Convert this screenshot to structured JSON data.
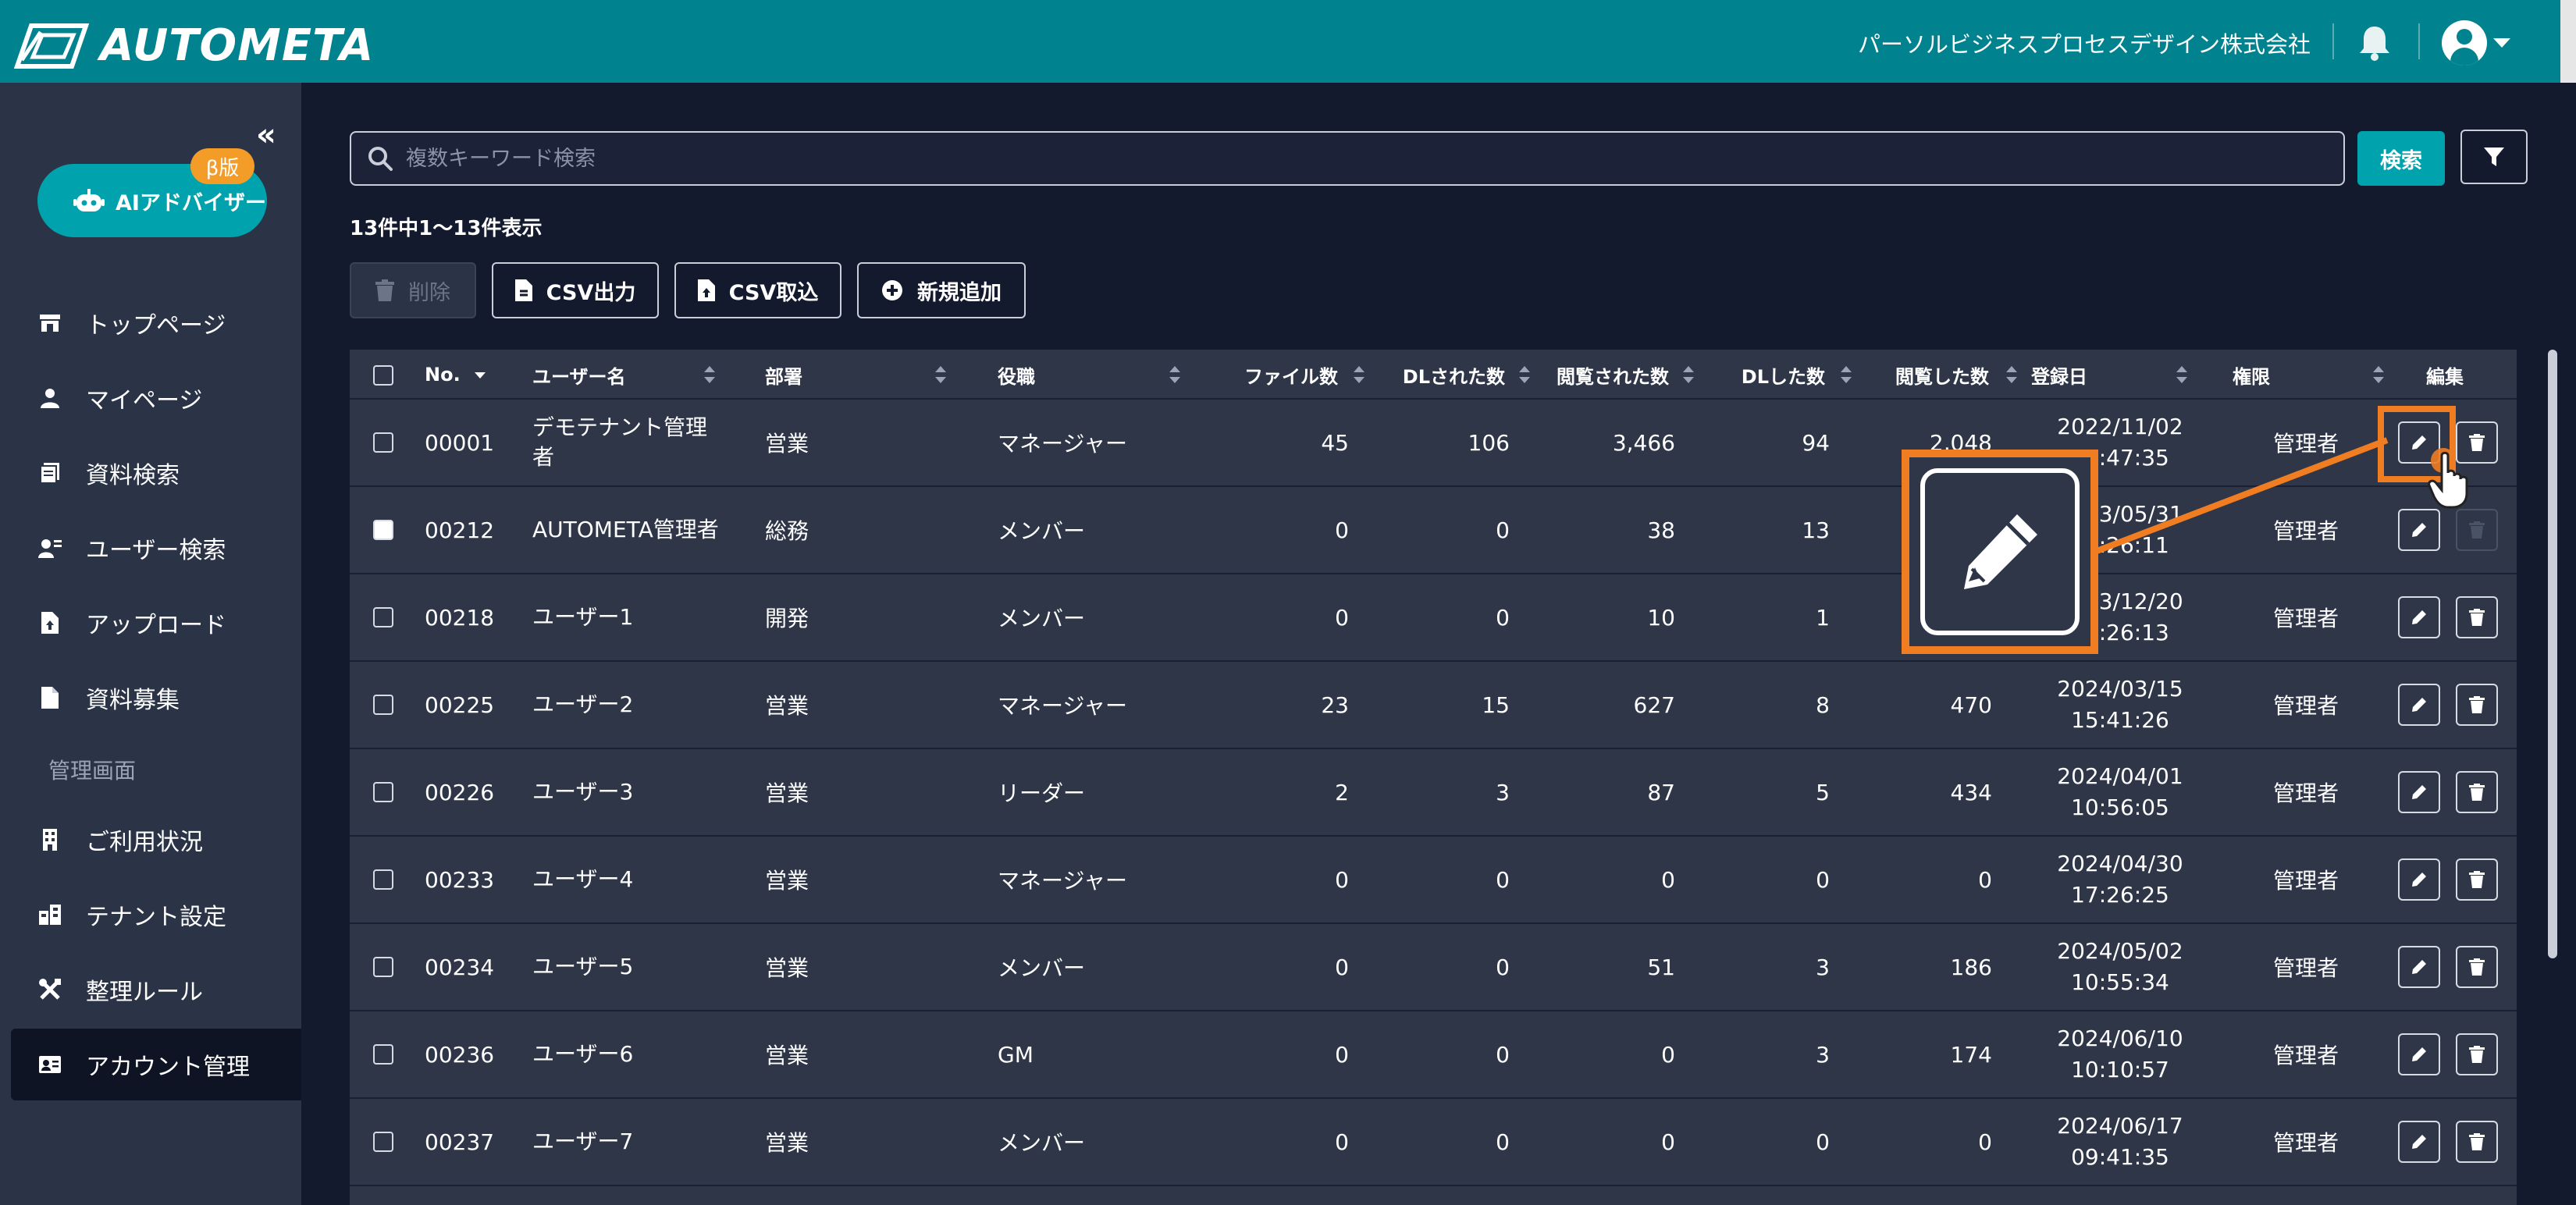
{
  "header": {
    "brand": "AUTOMETA",
    "company": "パーソルビジネスプロセスデザイン株式会社",
    "colors": {
      "header_bg": "#00838f",
      "accent": "#00a3ad",
      "highlight": "#f07d22"
    }
  },
  "sidebar": {
    "collapse_label": "«",
    "ai_button": {
      "label": "AIアドバイザー",
      "badge": "β版"
    },
    "items": [
      {
        "label": "トップページ",
        "icon": "store-icon"
      },
      {
        "label": "マイページ",
        "icon": "user-icon"
      },
      {
        "label": "資料検索",
        "icon": "document-search-icon"
      },
      {
        "label": "ユーザー検索",
        "icon": "user-search-icon"
      },
      {
        "label": "アップロード",
        "icon": "upload-file-icon"
      },
      {
        "label": "資料募集",
        "icon": "file-icon"
      }
    ],
    "admin_section": "管理画面",
    "admin_items": [
      {
        "label": "ご利用状況",
        "icon": "building-icon"
      },
      {
        "label": "テナント設定",
        "icon": "tenant-icon"
      },
      {
        "label": "整理ルール",
        "icon": "tools-icon"
      },
      {
        "label": "アカウント管理",
        "icon": "id-card-icon",
        "active": true
      }
    ]
  },
  "search": {
    "placeholder": "複数キーワード検索",
    "button": "検索"
  },
  "summary": "13件中1〜13件表示",
  "toolbar": {
    "delete": "削除",
    "csv_export": "CSV出力",
    "csv_import": "CSV取込",
    "add_new": "新規追加"
  },
  "table": {
    "headers": {
      "no": "No.",
      "username": "ユーザー名",
      "dept": "部署",
      "role": "役職",
      "files": "ファイル数",
      "downloaded": "DLされた数",
      "viewed_by": "閲覧された数",
      "dl_count": "DLした数",
      "view_count": "閲覧した数",
      "registered": "登録日",
      "permission": "権限",
      "edit": "編集"
    },
    "rows": [
      {
        "no": "00001",
        "name": "デモテナント管理者",
        "dept": "営業",
        "role": "マネージャー",
        "files": "45",
        "downloaded": "106",
        "viewed_by": "3,466",
        "dl_count": "94",
        "view_count": "2,048",
        "date": "2022/11/02",
        "time": "17:47:35",
        "perm": "管理者"
      },
      {
        "no": "00212",
        "name": "AUTOMETA管理者",
        "dept": "総務",
        "role": "メンバー",
        "files": "0",
        "downloaded": "0",
        "viewed_by": "38",
        "dl_count": "13",
        "view_count": "",
        "date": "2023/05/31",
        "time": "14:26:11",
        "perm": "管理者"
      },
      {
        "no": "00218",
        "name": "ユーザー1",
        "dept": "開発",
        "role": "メンバー",
        "files": "0",
        "downloaded": "0",
        "viewed_by": "10",
        "dl_count": "1",
        "view_count": "",
        "date": "2023/12/20",
        "time": "09:26:13",
        "perm": "管理者"
      },
      {
        "no": "00225",
        "name": "ユーザー2",
        "dept": "営業",
        "role": "マネージャー",
        "files": "23",
        "downloaded": "15",
        "viewed_by": "627",
        "dl_count": "8",
        "view_count": "470",
        "date": "2024/03/15",
        "time": "15:41:26",
        "perm": "管理者"
      },
      {
        "no": "00226",
        "name": "ユーザー3",
        "dept": "営業",
        "role": "リーダー",
        "files": "2",
        "downloaded": "3",
        "viewed_by": "87",
        "dl_count": "5",
        "view_count": "434",
        "date": "2024/04/01",
        "time": "10:56:05",
        "perm": "管理者"
      },
      {
        "no": "00233",
        "name": "ユーザー4",
        "dept": "営業",
        "role": "マネージャー",
        "files": "0",
        "downloaded": "0",
        "viewed_by": "0",
        "dl_count": "0",
        "view_count": "0",
        "date": "2024/04/30",
        "time": "17:26:25",
        "perm": "管理者"
      },
      {
        "no": "00234",
        "name": "ユーザー5",
        "dept": "営業",
        "role": "メンバー",
        "files": "0",
        "downloaded": "0",
        "viewed_by": "51",
        "dl_count": "3",
        "view_count": "186",
        "date": "2024/05/02",
        "time": "10:55:34",
        "perm": "管理者"
      },
      {
        "no": "00236",
        "name": "ユーザー6",
        "dept": "営業",
        "role": "GM",
        "files": "0",
        "downloaded": "0",
        "viewed_by": "0",
        "dl_count": "3",
        "view_count": "174",
        "date": "2024/06/10",
        "time": "10:10:57",
        "perm": "管理者"
      },
      {
        "no": "00237",
        "name": "ユーザー7",
        "dept": "営業",
        "role": "メンバー",
        "files": "0",
        "downloaded": "0",
        "viewed_by": "0",
        "dl_count": "0",
        "view_count": "0",
        "date": "2024/06/17",
        "time": "09:41:35",
        "perm": "管理者"
      }
    ]
  }
}
